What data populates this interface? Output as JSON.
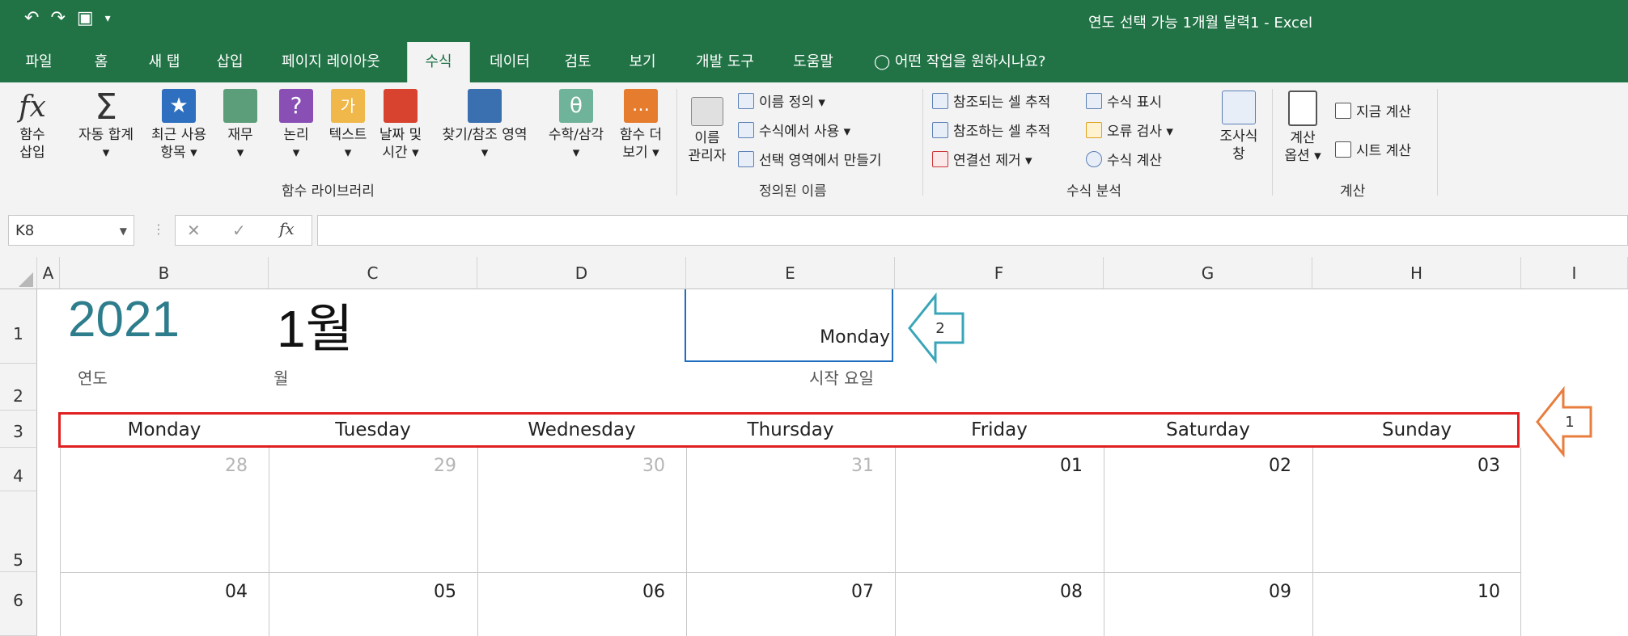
{
  "titlebar": {
    "window_title": "연도 선택 가능 1개월 달력1  -  Excel",
    "qat_undo": "↶",
    "qat_redo": "↷",
    "qat_save": "▣",
    "qat_more": "▾"
  },
  "tabs": [
    "파일",
    "홈",
    "새 탭",
    "삽입",
    "페이지 레이아웃",
    "수식",
    "데이터",
    "검토",
    "보기",
    "개발 도구",
    "도움말",
    "어떤 작업을 원하시나요?"
  ],
  "active_tab": "수식",
  "ribbon": {
    "library": {
      "insert_fn": [
        "함수",
        "삽입"
      ],
      "autosum": [
        "자동 합계",
        "▾"
      ],
      "recent": [
        "최근 사용",
        "항목 ▾"
      ],
      "finance": [
        "재무",
        "▾"
      ],
      "logic": [
        "논리",
        "▾"
      ],
      "text": [
        "텍스트",
        "▾"
      ],
      "datetime": [
        "날짜 및",
        "시간 ▾"
      ],
      "lookup": [
        "찾기/참조 영역",
        "▾"
      ],
      "math": [
        "수학/삼각",
        "▾"
      ],
      "more": [
        "함수 더",
        "보기 ▾"
      ],
      "group_label": "함수 라이브러리"
    },
    "names": {
      "manager": [
        "이름",
        "관리자"
      ],
      "define": "이름 정의 ▾",
      "use_in_formula": "수식에서 사용 ▾",
      "create_from_sel": "선택 영역에서 만들기",
      "group_label": "정의된 이름"
    },
    "audit": {
      "trace_prec": "참조되는 셀 추적",
      "trace_dep": "참조하는 셀 추적",
      "remove_arrows": "연결선 제거 ▾",
      "show_formulas": "수식 표시",
      "error_check": "오류 검사 ▾",
      "evaluate": "수식 계산",
      "watch": [
        "조사식",
        "창"
      ],
      "group_label": "수식 분석"
    },
    "calc": {
      "options": [
        "계산",
        "옵션 ▾"
      ],
      "calc_now": "지금 계산",
      "calc_sheet": "시트 계산",
      "group_label": "계산"
    }
  },
  "formula_bar": {
    "name_box": "K8",
    "cancel": "✕",
    "enter": "✓",
    "fx": "fx"
  },
  "columns": [
    "A",
    "B",
    "C",
    "D",
    "E",
    "F",
    "G",
    "H",
    "I"
  ],
  "rows": [
    "1",
    "2",
    "3",
    "4",
    "5",
    "6"
  ],
  "sheet": {
    "year": "2021",
    "month": "1월",
    "start_day": "Monday",
    "year_label": "연도",
    "month_label": "월",
    "start_label": "시작 요일",
    "weekdays": [
      "Monday",
      "Tuesday",
      "Wednesday",
      "Thursday",
      "Friday",
      "Saturday",
      "Sunday"
    ],
    "week1": [
      "28",
      "29",
      "30",
      "31",
      "01",
      "02",
      "03"
    ],
    "week2": [
      "04",
      "05",
      "06",
      "07",
      "08",
      "09",
      "10"
    ]
  },
  "callouts": {
    "one": "1",
    "two": "2"
  },
  "colors": {
    "excel_green": "#217346",
    "year_teal": "#2e7d8c",
    "callout_teal": "#3aa5b8",
    "callout_orange": "#e87d3e",
    "highlight_red": "#e02020",
    "selection_blue": "#1f6dbf"
  }
}
